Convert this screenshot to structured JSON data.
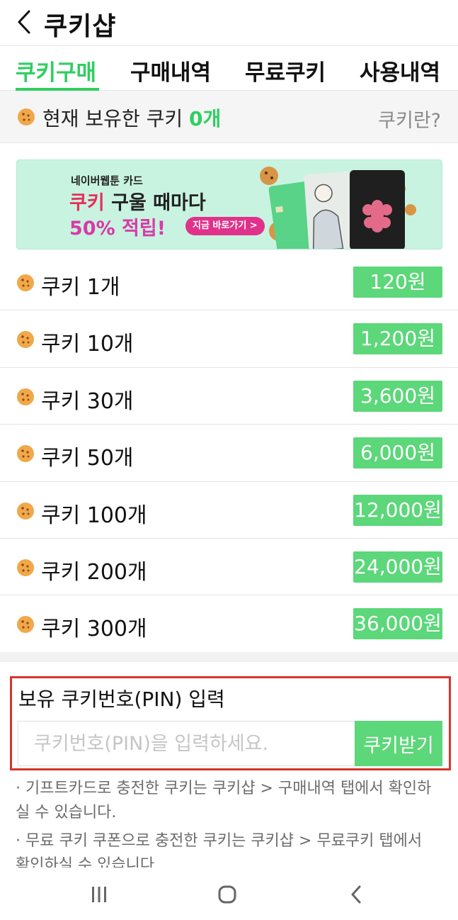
{
  "header": {
    "title": "쿠키샵",
    "back_icon": "chevron-left-icon"
  },
  "tabs": [
    {
      "label": "쿠키구매",
      "active": true
    },
    {
      "label": "구매내역",
      "active": false
    },
    {
      "label": "무료쿠키",
      "active": false
    },
    {
      "label": "사용내역",
      "active": false
    }
  ],
  "balance": {
    "prefix": "현재 보유한 쿠키",
    "count": "0개",
    "help_link": "쿠키란?"
  },
  "banner": {
    "sub": "네이버웹툰 카드",
    "main_red": "쿠키",
    "main_rest": " 구울 때마다",
    "percent": "50% 적립!",
    "cta": "지금 바로가기 >"
  },
  "products": [
    {
      "name": "쿠키 1개",
      "price": "120원"
    },
    {
      "name": "쿠키 10개",
      "price": "1,200원"
    },
    {
      "name": "쿠키 30개",
      "price": "3,600원"
    },
    {
      "name": "쿠키 50개",
      "price": "6,000원"
    },
    {
      "name": "쿠키 100개",
      "price": "12,000원"
    },
    {
      "name": "쿠키 200개",
      "price": "24,000원"
    },
    {
      "name": "쿠키 300개",
      "price": "36,000원"
    }
  ],
  "pin": {
    "label": "보유 쿠키번호(PIN) 입력",
    "placeholder": "쿠키번호(PIN)을 입력하세요.",
    "value": "",
    "button": "쿠키받기"
  },
  "notices": [
    "· 기프트카드로 충전한 쿠키는 쿠키샵 > 구매내역 탭에서 확인하실 수 있습니다.",
    "· 무료 쿠키 쿠폰으로 충전한 쿠키는 쿠키샵 > 무료쿠키 탭에서 확인하실 수 있습니다."
  ],
  "navbar": {
    "recents_icon": "recents-icon",
    "home_icon": "home-icon",
    "back_icon": "back-icon"
  },
  "colors": {
    "accent": "#2fce60",
    "price_button": "#5cd77a",
    "highlight_border": "#d6352e",
    "cookie": "#f0a84a"
  }
}
